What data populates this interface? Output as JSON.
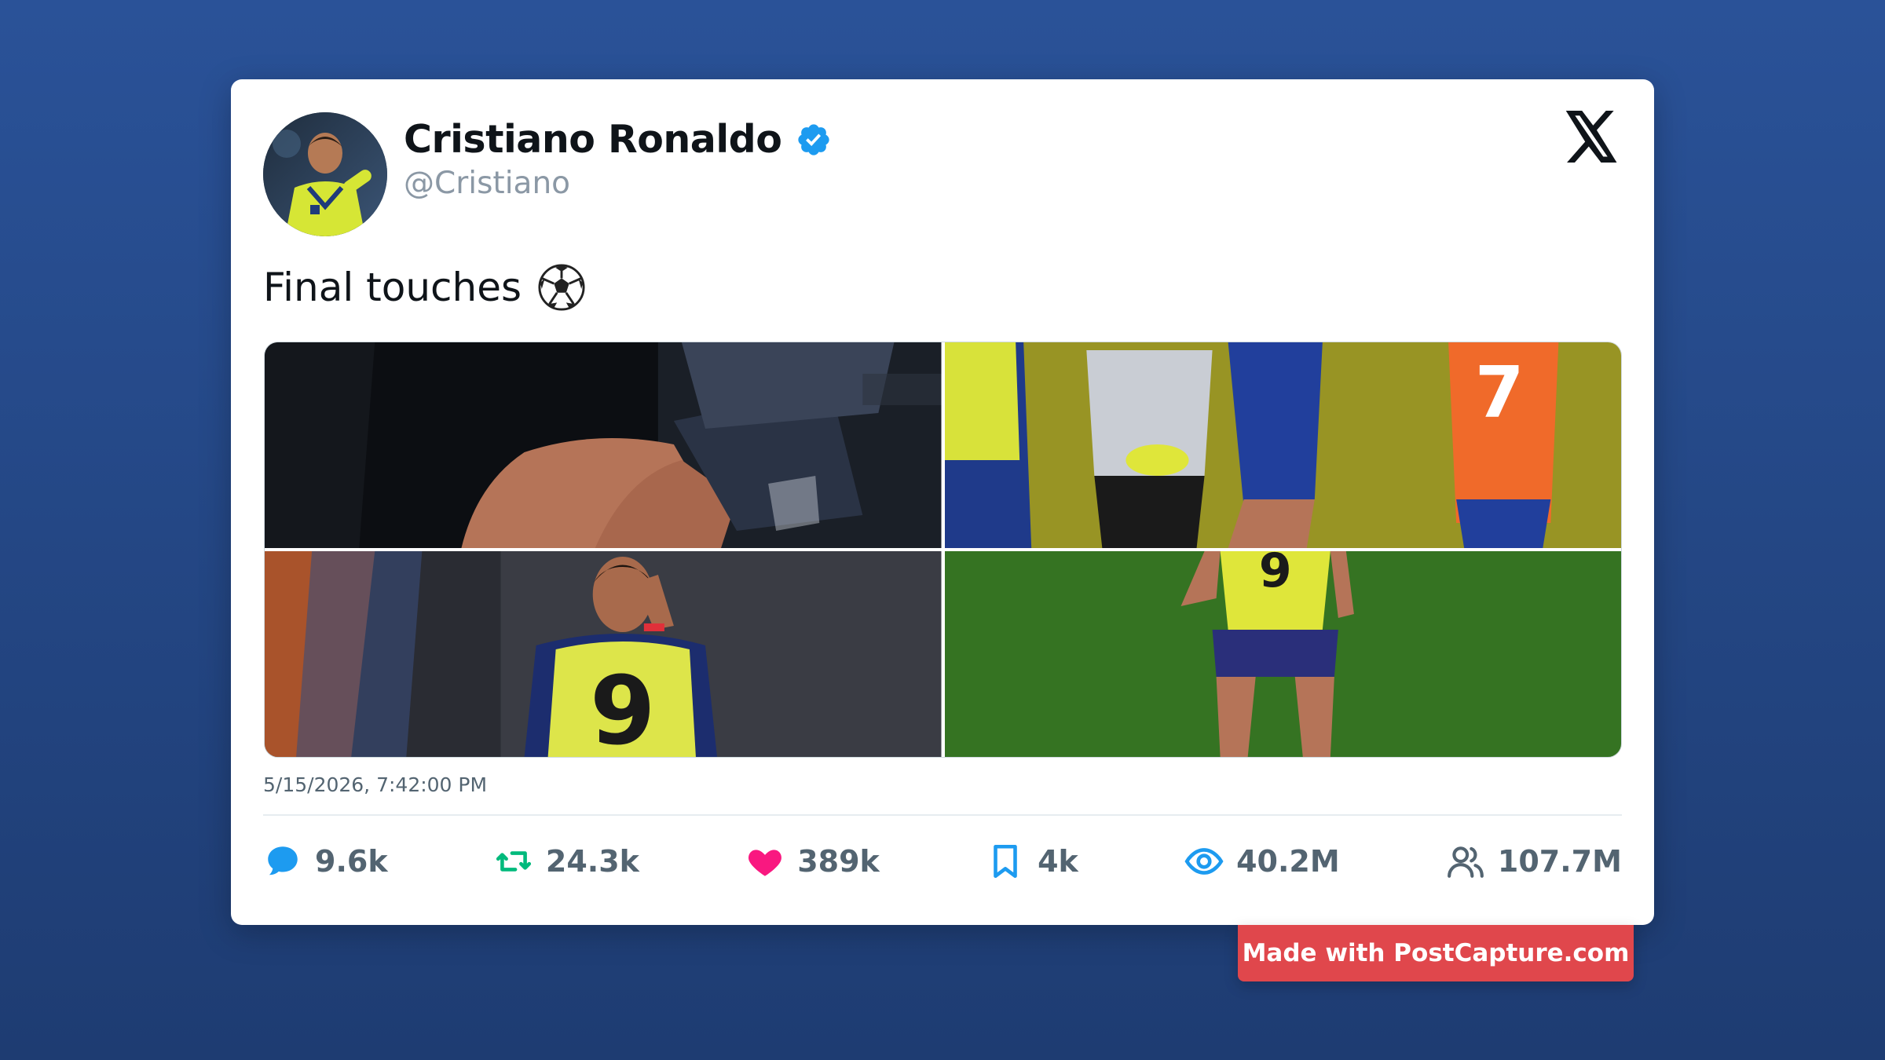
{
  "author": {
    "name": "Cristiano Ronaldo",
    "handle": "@Cristiano",
    "verified": true,
    "avatar_icon": "profile-photo"
  },
  "platform_logo": "x-logo-icon",
  "tweet": {
    "text": "Final touches",
    "emoji": "soccer-ball-icon"
  },
  "media": [
    {
      "name": "photo-1",
      "icon": "training-photo"
    },
    {
      "name": "photo-2",
      "icon": "training-photo"
    },
    {
      "name": "photo-3",
      "icon": "training-photo"
    },
    {
      "name": "photo-4",
      "icon": "training-photo"
    }
  ],
  "timestamp": "5/15/2026, 7:42:00 PM",
  "stats": {
    "replies": "9.6k",
    "retweets": "24.3k",
    "likes": "389k",
    "bookmarks": "4k",
    "views": "40.2M",
    "followers": "107.7M"
  },
  "colors": {
    "reply": "#1d9bf0",
    "retweet": "#00ba7c",
    "like": "#f91880",
    "bookmark": "#1d9bf0",
    "views": "#1d9bf0",
    "followers": "#536471",
    "verified": "#1d9bf0",
    "badge_bg": "#e0474c"
  },
  "watermark": "Made with PostCapture.com"
}
